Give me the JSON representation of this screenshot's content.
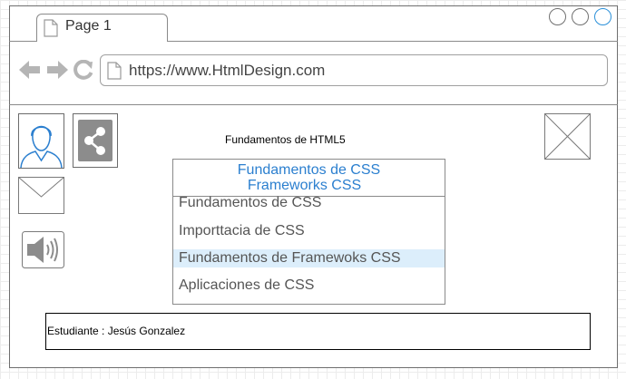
{
  "browser": {
    "tab_label": "Page 1",
    "url": "https://www.HtmlDesign.com",
    "window_buttons": [
      "minimize",
      "maximize",
      "close"
    ],
    "close_button_color": "#2b90d9"
  },
  "content": {
    "title": "Fundamentos de HTML5",
    "list": {
      "header_line1": "Fundamentos de CSS",
      "header_line2": "Frameworks CSS",
      "items": [
        {
          "label": "Fundamentos de CSS",
          "selected": false
        },
        {
          "label": "Importtacia de CSS",
          "selected": false
        },
        {
          "label": "Fundamentos de Framewoks CSS",
          "selected": true
        },
        {
          "label": "Aplicaciones de CSS",
          "selected": false
        }
      ]
    },
    "student_label": "Estudiante : Jesús Gonzalez",
    "icons": [
      "user-avatar-icon",
      "share-icon",
      "mail-icon",
      "speaker-icon",
      "image-placeholder-icon"
    ],
    "accent_color": "#2b7fcf",
    "selection_color": "#dceefb"
  }
}
